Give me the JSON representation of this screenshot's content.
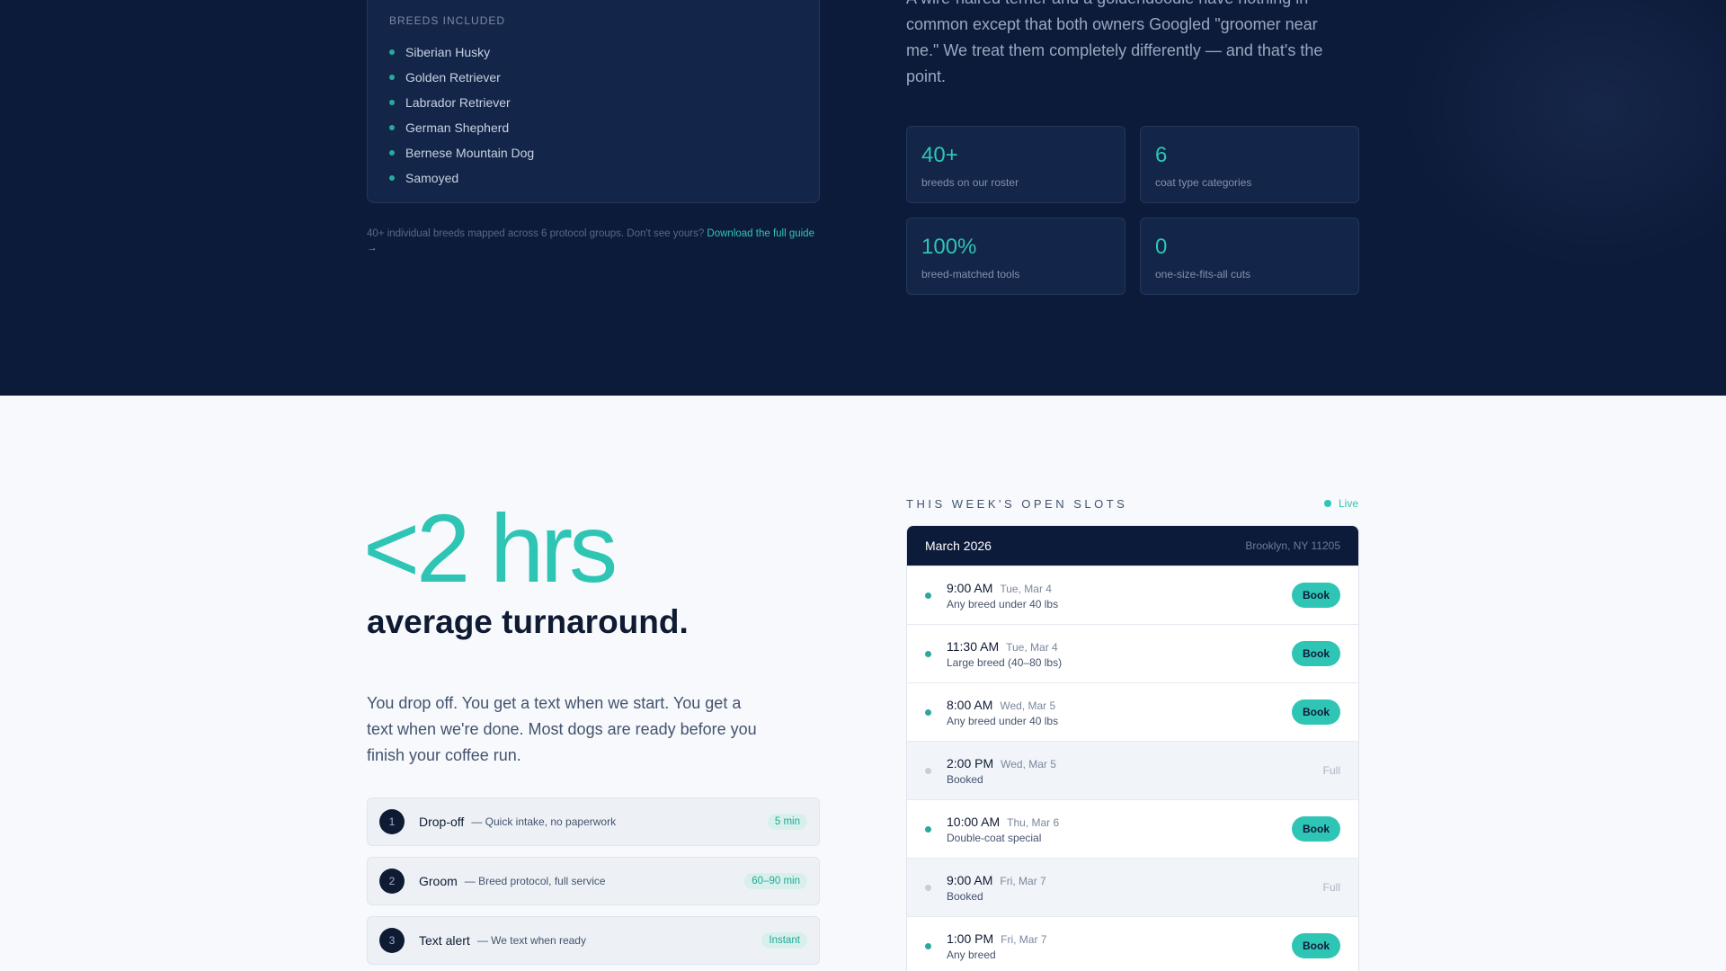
{
  "breeds": {
    "heading": "Breeds Included",
    "items": [
      "Siberian Husky",
      "Golden Retriever",
      "Labrador Retriever",
      "German Shepherd",
      "Bernese Mountain Dog",
      "Samoyed"
    ],
    "note": "40+ individual breeds mapped across 6 protocol groups. Don't see yours?",
    "note_link": "Download the full guide →"
  },
  "intro": {
    "text": "A wire-haired terrier and a goldendoodle have nothing in common except that both owners Googled \"groomer near me.\" We treat them completely differently — and that's the point."
  },
  "stats": [
    {
      "value": "40+",
      "label": "breeds on our roster"
    },
    {
      "value": "6",
      "label": "coat type categories"
    },
    {
      "value": "100%",
      "label": "breed-matched tools"
    },
    {
      "value": "0",
      "label": "one-size-fits-all cuts"
    }
  ],
  "turnaround": {
    "big_stat": "<2 hrs",
    "headline": "average turnaround.",
    "lead": "You drop off. You get a text when we start. You get a text when we're done. Most dogs are ready before you finish your coffee run."
  },
  "steps": [
    {
      "num": "1",
      "title": "Drop-off",
      "desc": "— Quick intake, no paperwork",
      "badge": "5 min"
    },
    {
      "num": "2",
      "title": "Groom",
      "desc": "— Breed protocol, full service",
      "badge": "60–90 min"
    },
    {
      "num": "3",
      "title": "Text alert",
      "desc": "— We text when ready",
      "badge": "Instant"
    }
  ],
  "slots": {
    "heading": "THIS WEEK'S OPEN SLOTS",
    "live_label": "Live",
    "month": "March 2026",
    "location": "Brooklyn, NY 11205",
    "book_label": "Book",
    "full_label": "Full",
    "items": [
      {
        "time": "9:00 AM",
        "day": "Tue, Mar 4",
        "desc": "Any breed under 40 lbs",
        "status": "open"
      },
      {
        "time": "11:30 AM",
        "day": "Tue, Mar 4",
        "desc": "Large breed (40–80 lbs)",
        "status": "open"
      },
      {
        "time": "8:00 AM",
        "day": "Wed, Mar 5",
        "desc": "Any breed under 40 lbs",
        "status": "open"
      },
      {
        "time": "2:00 PM",
        "day": "Wed, Mar 5",
        "desc": "Booked",
        "status": "full"
      },
      {
        "time": "10:00 AM",
        "day": "Thu, Mar 6",
        "desc": "Double-coat special",
        "status": "open"
      },
      {
        "time": "9:00 AM",
        "day": "Fri, Mar 7",
        "desc": "Booked",
        "status": "full"
      },
      {
        "time": "1:00 PM",
        "day": "Fri, Mar 7",
        "desc": "Any breed",
        "status": "open"
      }
    ]
  },
  "colors": {
    "navy": "#0d1b3a",
    "teal": "#2ec5b5",
    "light_bg": "#f7f9fc"
  }
}
